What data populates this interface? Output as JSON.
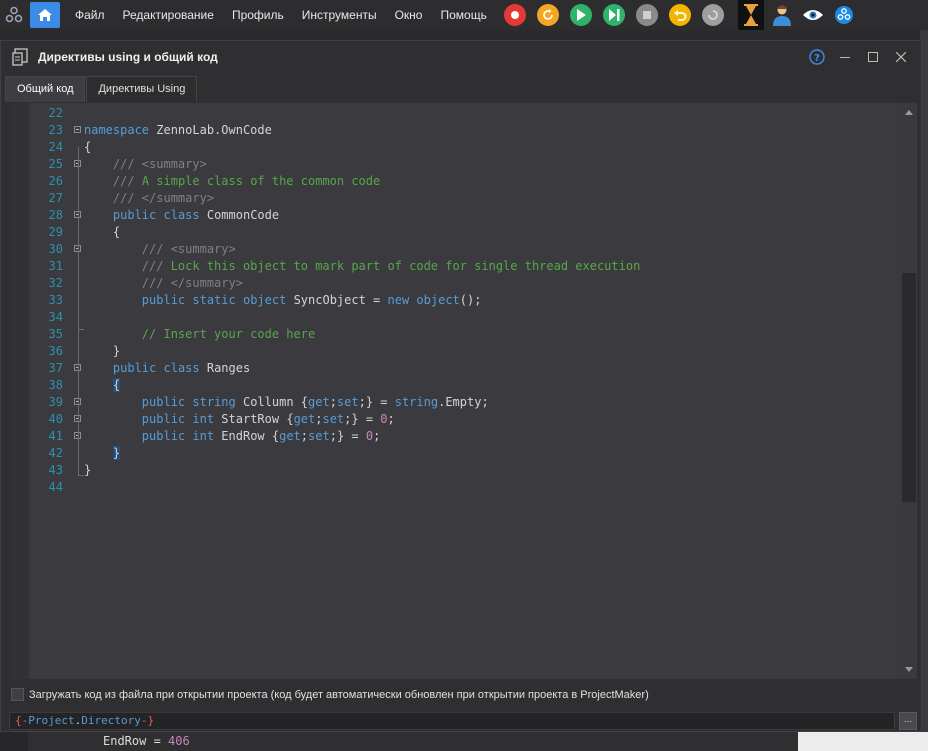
{
  "menubar": {
    "items": [
      "Файл",
      "Редактирование",
      "Профиль",
      "Инструменты",
      "Окно",
      "Помощь"
    ],
    "toolbar": [
      {
        "name": "record-icon",
        "color": "#e53935"
      },
      {
        "name": "refresh-icon",
        "color": "#f5a623"
      },
      {
        "name": "play-icon",
        "color": "#2fb36b"
      },
      {
        "name": "step-icon",
        "color": "#2fb36b"
      },
      {
        "name": "stop-icon",
        "color": "#8a8a8a"
      },
      {
        "name": "undo-icon",
        "color": "#f5b400"
      },
      {
        "name": "redo-icon",
        "color": "#9e9e9e"
      }
    ]
  },
  "dialog": {
    "title": "Директивы using и общий код",
    "tabs": [
      "Общий код",
      "Директивы Using"
    ],
    "active_tab": 0
  },
  "editor": {
    "lines": [
      {
        "n": "22",
        "text": ""
      },
      {
        "n": "23",
        "text": "namespace ZennoLab.OwnCode"
      },
      {
        "n": "24",
        "text": "{"
      },
      {
        "n": "25",
        "text": "    /// <summary>"
      },
      {
        "n": "26",
        "text": "    /// A simple class of the common code"
      },
      {
        "n": "27",
        "text": "    /// </summary>"
      },
      {
        "n": "28",
        "text": "    public class CommonCode"
      },
      {
        "n": "29",
        "text": "    {"
      },
      {
        "n": "30",
        "text": "        /// <summary>"
      },
      {
        "n": "31",
        "text": "        /// Lock this object to mark part of code for single thread execution"
      },
      {
        "n": "32",
        "text": "        /// </summary>"
      },
      {
        "n": "33",
        "text": "        public static object SyncObject = new object();"
      },
      {
        "n": "34",
        "text": ""
      },
      {
        "n": "35",
        "text": "        // Insert your code here"
      },
      {
        "n": "36",
        "text": "    }"
      },
      {
        "n": "37",
        "text": "    public class Ranges"
      },
      {
        "n": "38",
        "text": "    {"
      },
      {
        "n": "39",
        "text": "        public string Collumn {get;set;} = string.Empty;"
      },
      {
        "n": "40",
        "text": "        public int StartRow {get;set;} = 0;"
      },
      {
        "n": "41",
        "text": "        public int EndRow {get;set;} = 0;"
      },
      {
        "n": "42",
        "text": "    }"
      },
      {
        "n": "43",
        "text": "}"
      },
      {
        "n": "44",
        "text": ""
      }
    ]
  },
  "load_from_file_label": "Загружать код из файла при открытии проекта (код будет автоматически обновлен при открытии проекта в ProjectMaker)",
  "path_value": "{-Project.Directory-}",
  "browse_label": "...",
  "background_text": "EndRow = 406"
}
